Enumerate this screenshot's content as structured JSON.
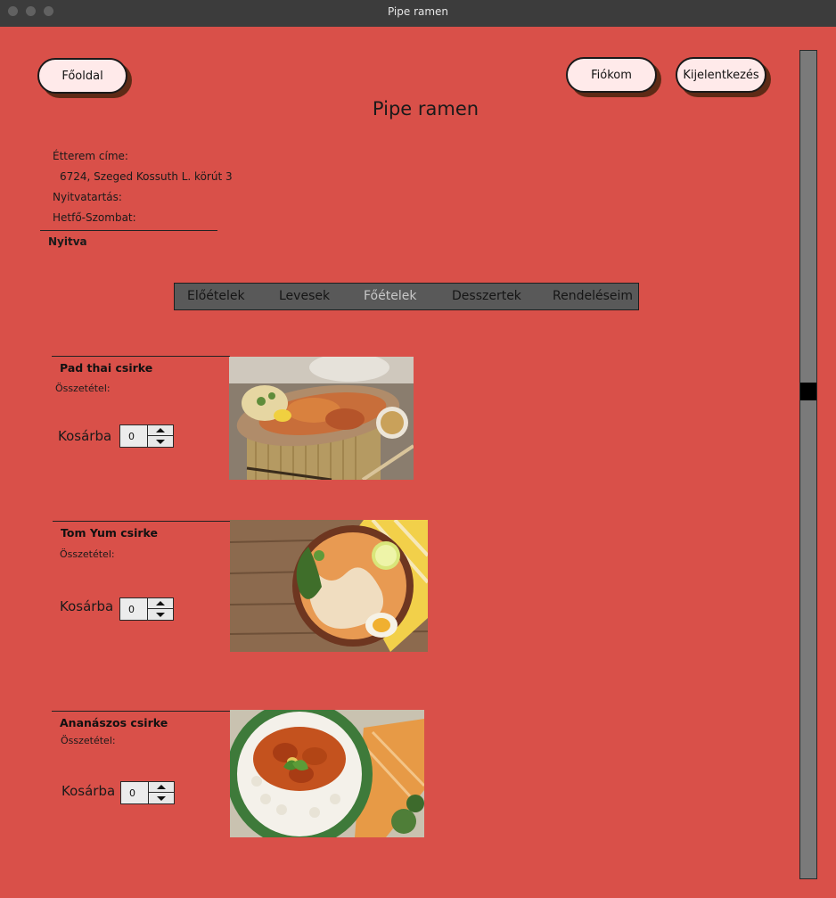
{
  "window": {
    "title": "Pipe ramen"
  },
  "header": {
    "home_label": "Főoldal",
    "account_label": "Fiókom",
    "logout_label": "Kijelentkezés",
    "page_title": "Pipe ramen"
  },
  "info": {
    "address_label": "Étterem címe:",
    "address_value": "6724, Szeged Kossuth L. körút 3",
    "hours_label": "Nyitvatartás:",
    "days_label": "Hetfő-Szombat:",
    "status": "Nyitva"
  },
  "tabs": [
    "Előételek",
    "Levesek",
    "Főételek",
    "Desszertek",
    "Rendeléseim"
  ],
  "active_tab": "Főételek",
  "foods": [
    {
      "name": "Pad thai csirke",
      "composition_label": "Összetétel:",
      "cart_label": "Kosárba",
      "quantity": "0",
      "image": "pad-thai-photo"
    },
    {
      "name": "Tom Yum csirke",
      "composition_label": "Összetétel:",
      "cart_label": "Kosárba",
      "quantity": "0",
      "image": "tom-yum-photo"
    },
    {
      "name": "Ananászos csirke",
      "composition_label": "Összetétel:",
      "cart_label": "Kosárba",
      "quantity": "0",
      "image": "pineapple-chicken-photo"
    }
  ],
  "colors": {
    "background": "#d95049",
    "button_fill": "#ffeaea",
    "tab_bar": "#595959",
    "titlebar": "#3c3c3c"
  }
}
